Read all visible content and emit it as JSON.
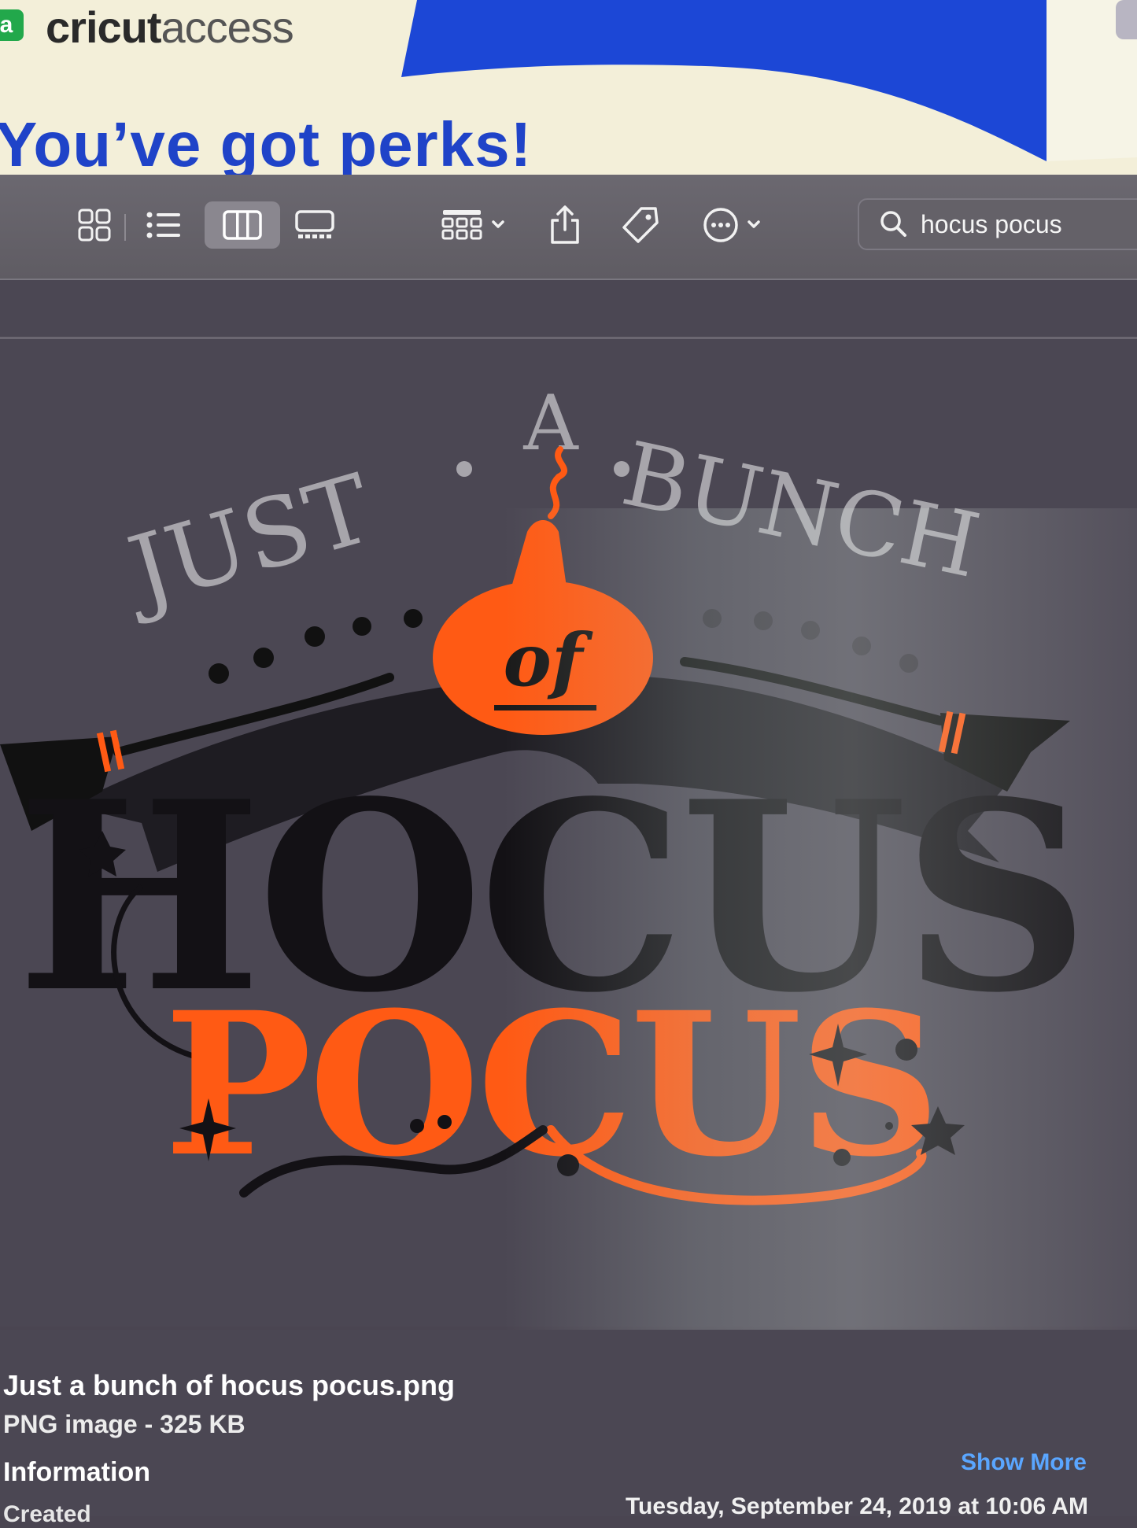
{
  "banner": {
    "logo_badge": "a",
    "brand_bold": "cricut",
    "brand_light": "access",
    "headline": "You’ve got perks!"
  },
  "toolbar": {
    "view_icons": [
      "icon-view-icon",
      "list-view-icon",
      "column-view-icon",
      "gallery-view-icon"
    ],
    "active_view": "column-view-icon",
    "action_icons": [
      "group-icon",
      "share-icon",
      "tag-icon",
      "more-icon"
    ],
    "search": {
      "value": "hocus pocus"
    }
  },
  "preview": {
    "art_top_words": [
      "JUST",
      "A",
      "BUNCH"
    ],
    "art_of": "of",
    "art_main": "HOCUS",
    "art_sub": "POCUS",
    "colors": {
      "orange": "#ff5a14",
      "black": "#111111",
      "banner_gray": "#9c9aa0"
    }
  },
  "info": {
    "filename": "Just a bunch of hocus pocus.png",
    "filetype": "PNG image - 325 KB",
    "section_title": "Information",
    "show_more": "Show More",
    "created_label": "Created",
    "created_value": "Tuesday, September 24, 2019 at 10:06 AM"
  }
}
